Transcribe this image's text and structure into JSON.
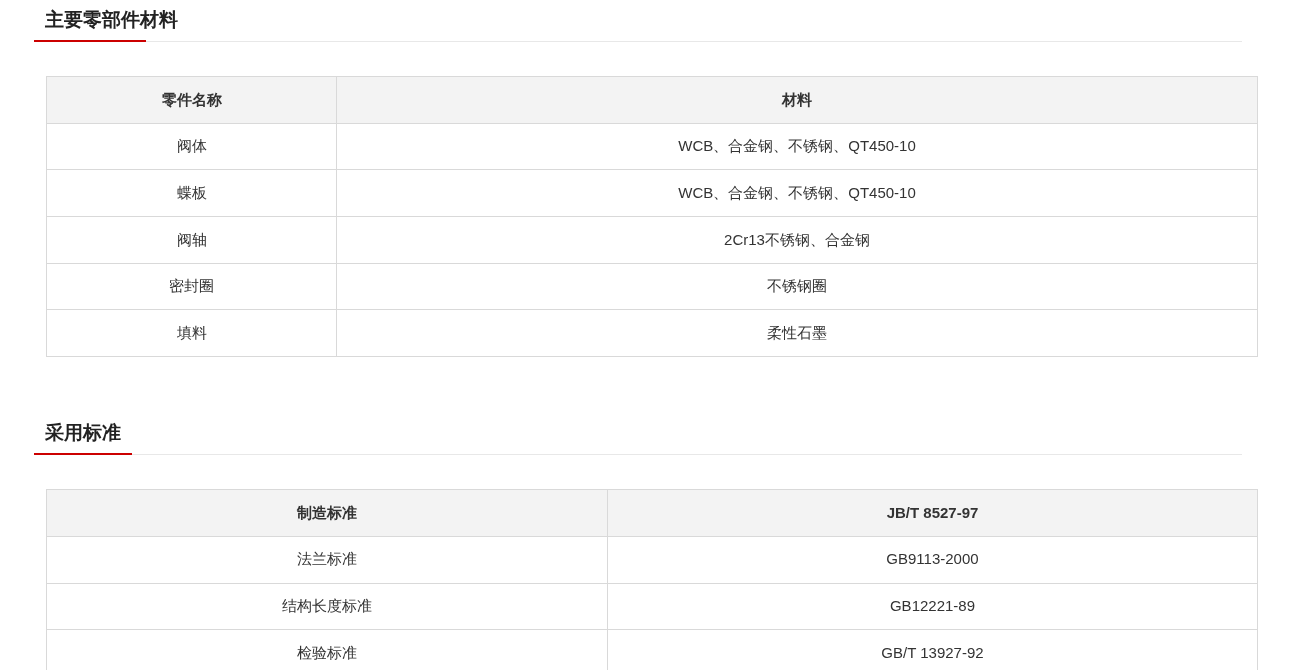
{
  "sections": [
    {
      "title": "主要零部件材料",
      "table": {
        "columns": [
          "零件名称",
          "材料"
        ],
        "rows": [
          [
            "阀体",
            "WCB、合金钢、不锈钢、QT450-10"
          ],
          [
            "蝶板",
            "WCB、合金钢、不锈钢、QT450-10"
          ],
          [
            "阀轴",
            "2Cr13不锈钢、合金钢"
          ],
          [
            "密封圈",
            "不锈钢圈"
          ],
          [
            "填料",
            "柔性石墨"
          ]
        ]
      }
    },
    {
      "title": "采用标准",
      "table": {
        "columns": [
          "制造标准",
          "JB/T 8527-97"
        ],
        "rows": [
          [
            "法兰标准",
            "GB9113-2000"
          ],
          [
            "结构长度标准",
            "GB12221-89"
          ],
          [
            "检验标准",
            "GB/T 13927-92"
          ]
        ]
      }
    }
  ]
}
